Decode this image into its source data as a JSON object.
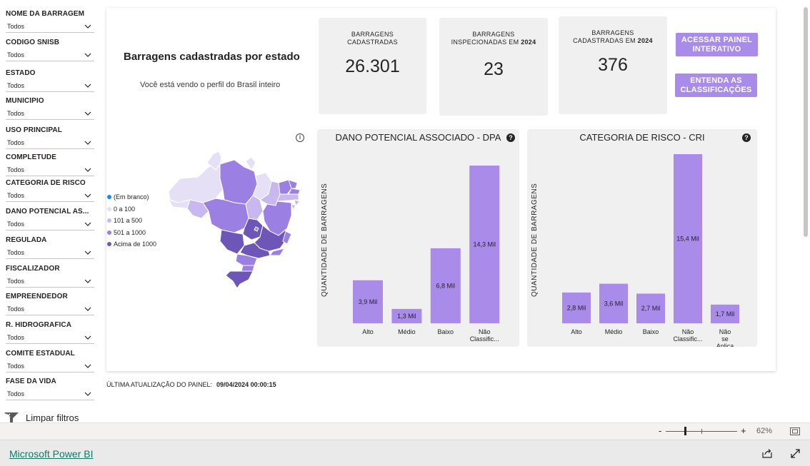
{
  "filters": [
    {
      "label": "NOME DA BARRAGEM",
      "value": "Todos"
    },
    {
      "label": "CÓDIGO SNISB",
      "value": "Todos"
    },
    {
      "label": "ESTADO",
      "value": "Todos"
    },
    {
      "label": "MUNICÍPIO",
      "value": "Todos"
    },
    {
      "label": "USO PRINCIPAL",
      "value": "Todos"
    },
    {
      "label": "COMPLETUDE",
      "value": "Todos"
    },
    {
      "label": "CATEGORIA DE RISCO",
      "value": "Todos"
    },
    {
      "label": "DANO POTENCIAL AS...",
      "value": "Todos"
    },
    {
      "label": "REGULADA",
      "value": "Todos"
    },
    {
      "label": "FISCALIZADOR",
      "value": "Todos"
    },
    {
      "label": "EMPREENDEDOR",
      "value": "Todos"
    },
    {
      "label": "R. HIDROGRAFICA",
      "value": "Todos"
    },
    {
      "label": "COMITÊ ESTADUAL",
      "value": "Todos"
    },
    {
      "label": "FASE DA VIDA",
      "value": "Todos"
    }
  ],
  "clear_filters": "Limpar filtros",
  "header": {
    "title": "Barragens cadastradas por estado",
    "subtitle": "Você está vendo o perfil do Brasil inteiro"
  },
  "kpis": [
    {
      "label_1": "BARRAGENS",
      "label_2": "CADASTRADAS",
      "year": "",
      "value": "26.301"
    },
    {
      "label_1": "BARRAGENS",
      "label_2": "INSPECIONADAS EM ",
      "year": "2024",
      "value": "23"
    },
    {
      "label_1": "BARRAGENS",
      "label_2": "CADASTRADAS EM ",
      "year": "2024",
      "value": "376"
    }
  ],
  "buttons": {
    "panel": "ACESSAR PAINEL INTERATIVO",
    "classifications": "ENTENDA AS CLASSIFICAÇÕES"
  },
  "map_legend": [
    {
      "label": "(Em branco)",
      "color": "#118dff"
    },
    {
      "label": "0 a 100",
      "color": "#e6e0f7"
    },
    {
      "label": "101 a 500",
      "color": "#c9b8f0"
    },
    {
      "label": "501 a 1000",
      "color": "#9b7fe2"
    },
    {
      "label": "Acima de 1000",
      "color": "#6e55b8"
    }
  ],
  "colors": {
    "bar": "#a98bea",
    "button": "#a98bea",
    "panel": "#f0f0f0"
  },
  "chart_data": [
    {
      "type": "bar",
      "title": "DANO POTENCIAL ASSOCIADO - DPA",
      "ylabel": "QUANTIDADE DE BARRAGENS",
      "categories": [
        "Alto",
        "Médio",
        "Baixo",
        "Não Classific..."
      ],
      "values": [
        3.9,
        1.3,
        6.8,
        14.3
      ],
      "value_labels": [
        "3,9 Mil",
        "1,3 Mil",
        "6,8 Mil",
        "14,3 Mil"
      ],
      "ylim": [
        0,
        15.4
      ]
    },
    {
      "type": "bar",
      "title": "CATEGORIA DE RISCO - CRI",
      "ylabel": "QUANTIDADE DE BARRAGENS",
      "categories": [
        "Alto",
        "Médio",
        "Baixo",
        "Não Classific...",
        "Não se Aplica"
      ],
      "values": [
        2.8,
        3.6,
        2.7,
        15.4,
        1.7
      ],
      "value_labels": [
        "2,8 Mil",
        "3,6 Mil",
        "2,7 Mil",
        "15,4 Mil",
        "1,7 Mil"
      ],
      "ylim": [
        0,
        15.4
      ]
    }
  ],
  "last_update": {
    "label": "ÚLTIMA ATUALIZAÇÃO DO PAINEL:",
    "value": "09/04/2024 00:00:15"
  },
  "zoom": {
    "minus": "-",
    "plus": "+",
    "value": "62%"
  },
  "footer": {
    "brand": "Microsoft Power BI"
  }
}
